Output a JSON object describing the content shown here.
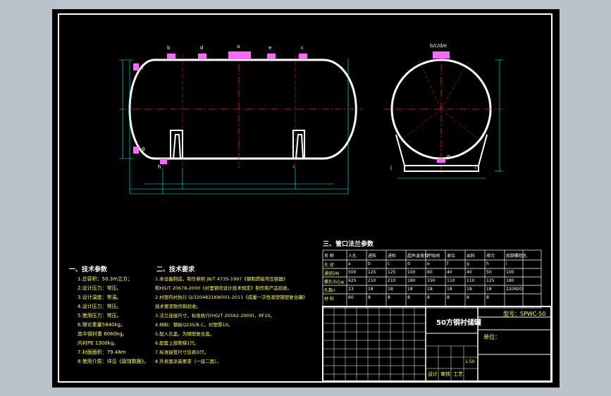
{
  "drawing": {
    "title_lines": [
      "一、技术参数",
      "二、技术要求",
      "三、管口法兰参数"
    ],
    "tech_params": [
      "1.总容积：50.3m立方；",
      "2.设计压力：常压。",
      "3.设计温度：常温。",
      "4.设计压力：常压。",
      "5.使用压力：常压。",
      "6.理论重量5840kg。",
      "  其中钢衬重 6060kg。",
      "      内衬PE 1300kg。",
      "7.衬面面积：79.48m",
      "8.使用介质：详见《腐蚀数据》。"
    ],
    "tech_reqs": [
      "1.本设备制造，制作参照 JB/T 4735-1997《钢制焊接常压容器》",
      "  和HG/T 20678-2000《衬里钢壳设计技术规定》制作和产品验收。",
      "2.衬塑内衬执行 Q/3204821KW001-2011《成量一次性滚塑钢塑复合罐》",
      "  技术要求制作和验收。",
      "3.法兰连接尺寸，标准执行(HG/T 20592-2009)，RF10。",
      "4.材料：钢板Q235/B.C，衬塑厚10。",
      "5.配人孔盖，为钢塑复合盖。",
      "6.配套上部爬梯1只。",
      "7.标准接管尺寸见表D只。",
      "8.外表面涂装要求（一底二面）。"
    ],
    "nozzle_table": {
      "headers": [
        "名 称",
        "人孔",
        "进料",
        "进料",
        "超声波液位",
        "呼吸阀",
        "液位",
        "出料",
        "排污",
        "底脚螺栓孔"
      ],
      "rows": [
        [
          "孔 径",
          "a",
          "b",
          "c",
          "d",
          "e",
          "f",
          "g",
          "h",
          "i"
        ],
        [
          "通径DN",
          "500",
          "125",
          "125",
          "100",
          "60",
          "40",
          "40",
          "50",
          "100"
        ],
        [
          "螺孔中心φ",
          "625",
          "210",
          "210",
          "180",
          "150",
          "110",
          "110",
          "125",
          "180"
        ],
        [
          "孔数n",
          "23",
          "18",
          "18",
          "18",
          "18",
          "18",
          "18",
          "18",
          "22(M20)"
        ],
        [
          "材 料",
          "60",
          "8",
          "8",
          "8",
          "8",
          "8",
          "8",
          "8",
          ""
        ]
      ]
    },
    "title_block": {
      "name": "50方钢衬储罐",
      "model": "型号：SPWC-50",
      "unit": "单位：",
      "row_labels": [
        "设计",
        "审核",
        "工艺"
      ],
      "scale": "1:50"
    },
    "tank_labels": {
      "side": [
        "a",
        "b",
        "c",
        "d",
        "e",
        "f",
        "g",
        "h",
        "i"
      ],
      "end": [
        "b/c/d/e",
        "g",
        "j",
        "i"
      ]
    },
    "colors": {
      "background": "#000000",
      "outline": "#ffffff",
      "dimension": "#00ffff",
      "centerline": "#ff2222",
      "text": "#ffff66",
      "nozzle": "#ff66ff",
      "sheet_border": "#b8c3cc"
    }
  }
}
